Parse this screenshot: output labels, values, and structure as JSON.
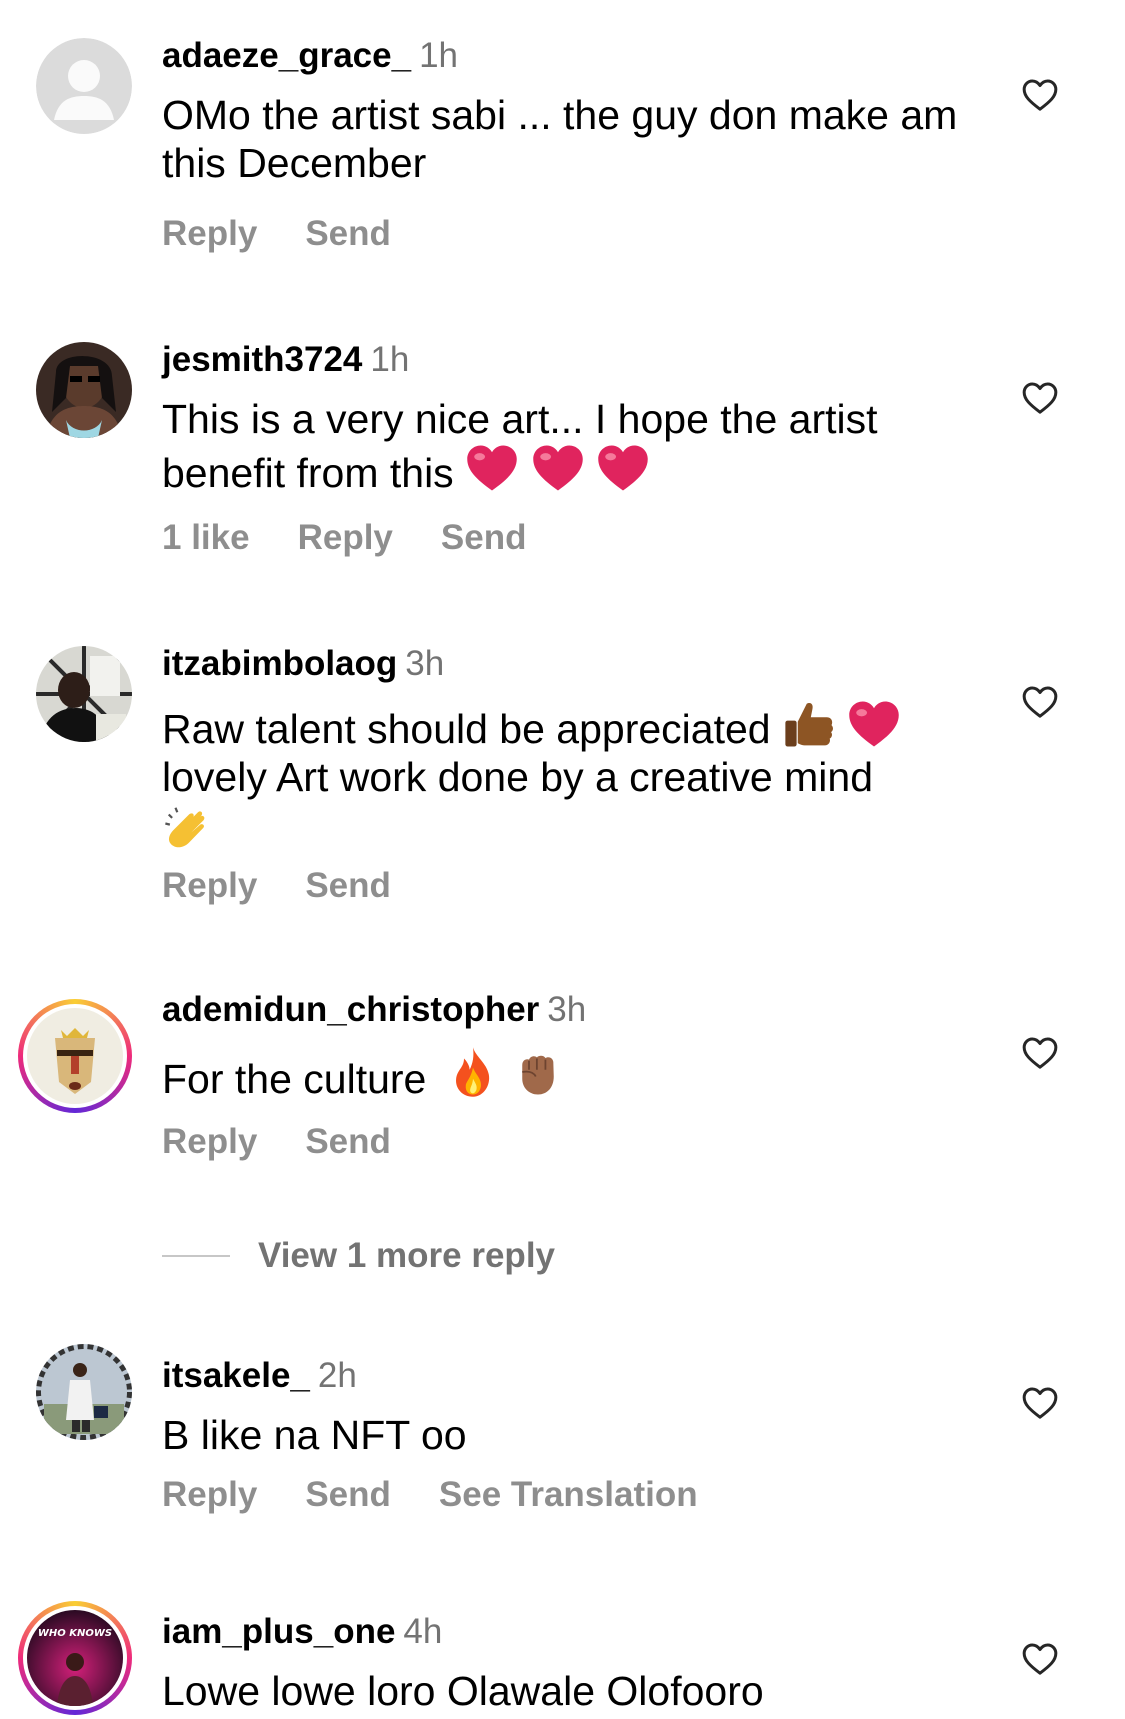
{
  "comments": [
    {
      "username": "adaeze_grace_",
      "time": "1h",
      "text": "OMo the artist sabi ... the guy don make am this December",
      "actions": [
        "Reply",
        "Send"
      ]
    },
    {
      "username": "jesmith3724",
      "time": "1h",
      "text": "This is a very nice art... I hope the artist benefit from this",
      "emojis": [
        "heart-emoji",
        "heart-emoji",
        "heart-emoji"
      ],
      "likes": "1 like",
      "actions": [
        "Reply",
        "Send"
      ]
    },
    {
      "username": "itzabimbolaog",
      "time": "3h",
      "text_line1": "Raw talent should be appreciated",
      "text_line2": "lovely Art work done by a creative mind",
      "emojis": [
        "thumbs-up-emoji",
        "heart-emoji",
        "clapping-hands-emoji"
      ],
      "actions": [
        "Reply",
        "Send"
      ]
    },
    {
      "username": "ademidun_christopher",
      "time": "3h",
      "text": "For the culture",
      "emojis": [
        "fire-emoji",
        "raised-fist-emoji"
      ],
      "actions": [
        "Reply",
        "Send"
      ],
      "view_more": "View 1 more reply"
    },
    {
      "username": "itsakele_",
      "time": "2h",
      "text": "B like na NFT oo",
      "actions": [
        "Reply",
        "Send",
        "See Translation"
      ]
    },
    {
      "username": "iam_plus_one",
      "time": "4h",
      "text": "Lowe lowe loro Olawale Olofooro",
      "avatar_text": "WHO KNOWS"
    }
  ],
  "colors": {
    "secondary_text": "#737373",
    "action_text": "#8e8e8e",
    "heart_red": "#e0245e"
  }
}
